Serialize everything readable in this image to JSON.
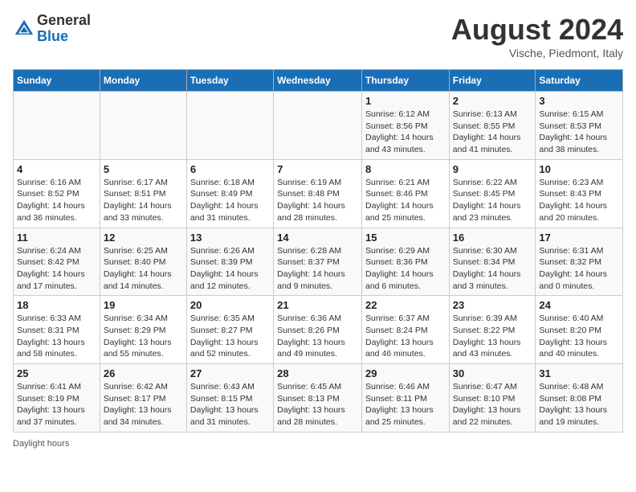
{
  "logo": {
    "general": "General",
    "blue": "Blue"
  },
  "title": {
    "month_year": "August 2024",
    "location": "Vische, Piedmont, Italy"
  },
  "days_of_week": [
    "Sunday",
    "Monday",
    "Tuesday",
    "Wednesday",
    "Thursday",
    "Friday",
    "Saturday"
  ],
  "weeks": [
    [
      {
        "day": "",
        "info": ""
      },
      {
        "day": "",
        "info": ""
      },
      {
        "day": "",
        "info": ""
      },
      {
        "day": "",
        "info": ""
      },
      {
        "day": "1",
        "info": "Sunrise: 6:12 AM\nSunset: 8:56 PM\nDaylight: 14 hours and 43 minutes."
      },
      {
        "day": "2",
        "info": "Sunrise: 6:13 AM\nSunset: 8:55 PM\nDaylight: 14 hours and 41 minutes."
      },
      {
        "day": "3",
        "info": "Sunrise: 6:15 AM\nSunset: 8:53 PM\nDaylight: 14 hours and 38 minutes."
      }
    ],
    [
      {
        "day": "4",
        "info": "Sunrise: 6:16 AM\nSunset: 8:52 PM\nDaylight: 14 hours and 36 minutes."
      },
      {
        "day": "5",
        "info": "Sunrise: 6:17 AM\nSunset: 8:51 PM\nDaylight: 14 hours and 33 minutes."
      },
      {
        "day": "6",
        "info": "Sunrise: 6:18 AM\nSunset: 8:49 PM\nDaylight: 14 hours and 31 minutes."
      },
      {
        "day": "7",
        "info": "Sunrise: 6:19 AM\nSunset: 8:48 PM\nDaylight: 14 hours and 28 minutes."
      },
      {
        "day": "8",
        "info": "Sunrise: 6:21 AM\nSunset: 8:46 PM\nDaylight: 14 hours and 25 minutes."
      },
      {
        "day": "9",
        "info": "Sunrise: 6:22 AM\nSunset: 8:45 PM\nDaylight: 14 hours and 23 minutes."
      },
      {
        "day": "10",
        "info": "Sunrise: 6:23 AM\nSunset: 8:43 PM\nDaylight: 14 hours and 20 minutes."
      }
    ],
    [
      {
        "day": "11",
        "info": "Sunrise: 6:24 AM\nSunset: 8:42 PM\nDaylight: 14 hours and 17 minutes."
      },
      {
        "day": "12",
        "info": "Sunrise: 6:25 AM\nSunset: 8:40 PM\nDaylight: 14 hours and 14 minutes."
      },
      {
        "day": "13",
        "info": "Sunrise: 6:26 AM\nSunset: 8:39 PM\nDaylight: 14 hours and 12 minutes."
      },
      {
        "day": "14",
        "info": "Sunrise: 6:28 AM\nSunset: 8:37 PM\nDaylight: 14 hours and 9 minutes."
      },
      {
        "day": "15",
        "info": "Sunrise: 6:29 AM\nSunset: 8:36 PM\nDaylight: 14 hours and 6 minutes."
      },
      {
        "day": "16",
        "info": "Sunrise: 6:30 AM\nSunset: 8:34 PM\nDaylight: 14 hours and 3 minutes."
      },
      {
        "day": "17",
        "info": "Sunrise: 6:31 AM\nSunset: 8:32 PM\nDaylight: 14 hours and 0 minutes."
      }
    ],
    [
      {
        "day": "18",
        "info": "Sunrise: 6:33 AM\nSunset: 8:31 PM\nDaylight: 13 hours and 58 minutes."
      },
      {
        "day": "19",
        "info": "Sunrise: 6:34 AM\nSunset: 8:29 PM\nDaylight: 13 hours and 55 minutes."
      },
      {
        "day": "20",
        "info": "Sunrise: 6:35 AM\nSunset: 8:27 PM\nDaylight: 13 hours and 52 minutes."
      },
      {
        "day": "21",
        "info": "Sunrise: 6:36 AM\nSunset: 8:26 PM\nDaylight: 13 hours and 49 minutes."
      },
      {
        "day": "22",
        "info": "Sunrise: 6:37 AM\nSunset: 8:24 PM\nDaylight: 13 hours and 46 minutes."
      },
      {
        "day": "23",
        "info": "Sunrise: 6:39 AM\nSunset: 8:22 PM\nDaylight: 13 hours and 43 minutes."
      },
      {
        "day": "24",
        "info": "Sunrise: 6:40 AM\nSunset: 8:20 PM\nDaylight: 13 hours and 40 minutes."
      }
    ],
    [
      {
        "day": "25",
        "info": "Sunrise: 6:41 AM\nSunset: 8:19 PM\nDaylight: 13 hours and 37 minutes."
      },
      {
        "day": "26",
        "info": "Sunrise: 6:42 AM\nSunset: 8:17 PM\nDaylight: 13 hours and 34 minutes."
      },
      {
        "day": "27",
        "info": "Sunrise: 6:43 AM\nSunset: 8:15 PM\nDaylight: 13 hours and 31 minutes."
      },
      {
        "day": "28",
        "info": "Sunrise: 6:45 AM\nSunset: 8:13 PM\nDaylight: 13 hours and 28 minutes."
      },
      {
        "day": "29",
        "info": "Sunrise: 6:46 AM\nSunset: 8:11 PM\nDaylight: 13 hours and 25 minutes."
      },
      {
        "day": "30",
        "info": "Sunrise: 6:47 AM\nSunset: 8:10 PM\nDaylight: 13 hours and 22 minutes."
      },
      {
        "day": "31",
        "info": "Sunrise: 6:48 AM\nSunset: 8:08 PM\nDaylight: 13 hours and 19 minutes."
      }
    ]
  ],
  "legend": {
    "daylight_label": "Daylight hours"
  }
}
